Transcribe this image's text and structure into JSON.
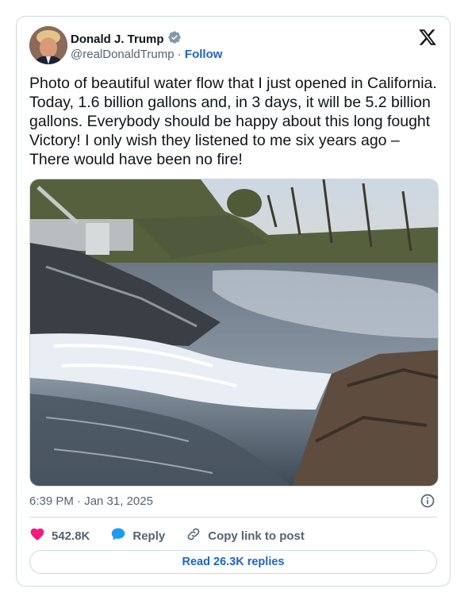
{
  "author": {
    "name": "Donald J. Trump",
    "handle": "@realDonaldTrump",
    "separator": "·",
    "follow_label": "Follow",
    "verified_icon": "verified-badge-icon",
    "verified_color": "#829aab"
  },
  "platform_icon": "x-logo-icon",
  "post": {
    "text": "Photo of beautiful water flow that I just opened in California. Today, 1.6 billion gallons and, in 3 days, it will be 5.2 billion gallons. Everybody should be happy about this long fought Victory! I only wish they listened to me six years ago – There would have been no fire!",
    "timestamp": "6:39 PM · Jan 31, 2025",
    "media_description": "River with rushing white water over dark rocks, dam structure at left, bare trees in background"
  },
  "actions": {
    "like_count": "542.8K",
    "reply_label": "Reply",
    "copy_label": "Copy link to post"
  },
  "read_replies_label": "Read 26.3K replies",
  "colors": {
    "accent": "#1d64c9",
    "like": "#f91880",
    "reply_bubble": "#1d9bf0",
    "muted_text": "#536471",
    "border": "#cfd9de"
  }
}
